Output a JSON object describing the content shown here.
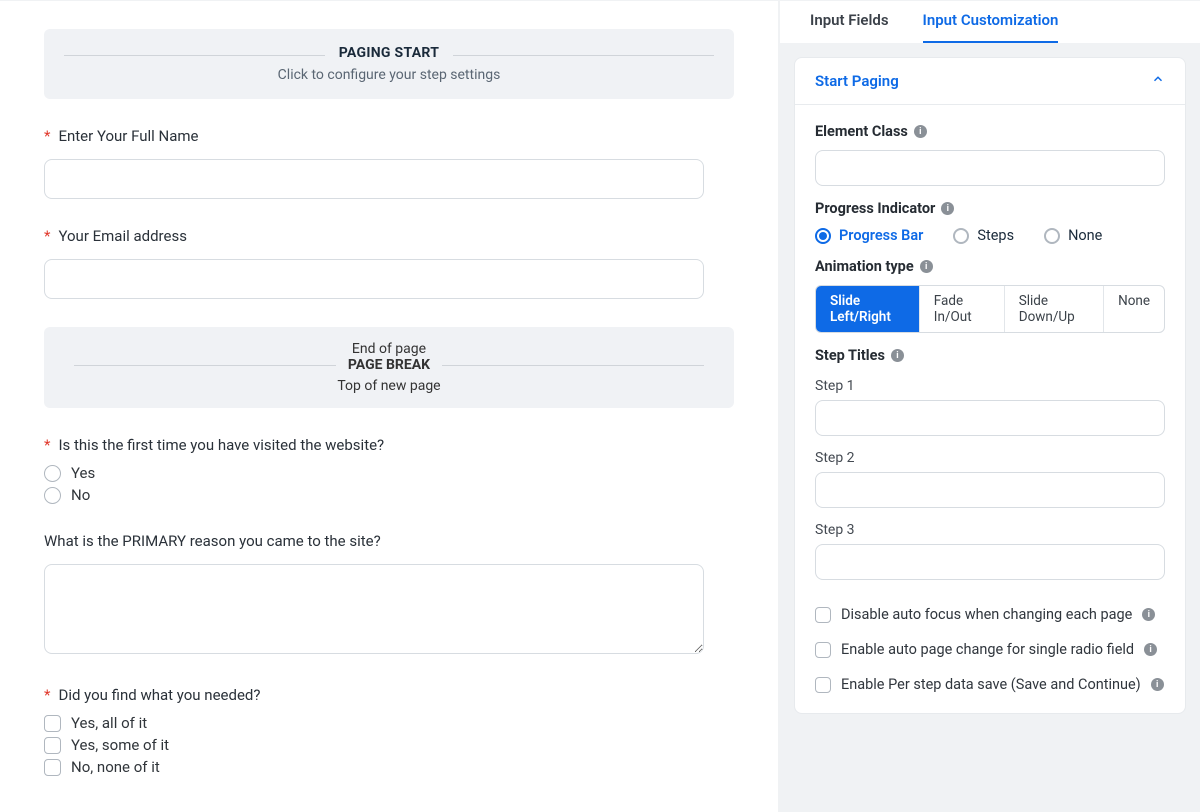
{
  "canvas": {
    "pagingStart": {
      "title": "PAGING START",
      "sub": "Click to configure your step settings"
    },
    "fields": {
      "fullName": {
        "label": "Enter Your Full Name",
        "required": true
      },
      "email": {
        "label": "Your Email address",
        "required": true
      },
      "firstVisit": {
        "label": "Is this the first time you have visited the website?",
        "required": true,
        "options": [
          "Yes",
          "No"
        ]
      },
      "primaryReason": {
        "label": "What is the PRIMARY reason you came to the site?",
        "required": false
      },
      "found": {
        "label": "Did you find what you needed?",
        "required": true,
        "options": [
          "Yes, all of it",
          "Yes, some of it",
          "No, none of it"
        ]
      }
    },
    "pageBreak": {
      "top": "End of page",
      "title": "PAGE BREAK",
      "bottom": "Top of new page"
    }
  },
  "sidebar": {
    "tabs": {
      "inputFields": "Input Fields",
      "inputCustomization": "Input Customization"
    },
    "panel": {
      "title": "Start Paging",
      "elementClass": {
        "label": "Element Class"
      },
      "progressIndicator": {
        "label": "Progress Indicator",
        "options": {
          "bar": "Progress Bar",
          "steps": "Steps",
          "none": "None"
        },
        "selected": "bar"
      },
      "animationType": {
        "label": "Animation type",
        "options": [
          "Slide Left/Right",
          "Fade In/Out",
          "Slide Down/Up",
          "None"
        ],
        "selected": 0
      },
      "stepTitles": {
        "label": "Step Titles",
        "steps": [
          "Step 1",
          "Step 2",
          "Step 3"
        ]
      },
      "checkboxes": {
        "disableAutoFocus": "Disable auto focus when changing each page",
        "enableAutoChange": "Enable auto page change for single radio field",
        "enablePerStep": "Enable Per step data save (Save and Continue)"
      }
    }
  }
}
